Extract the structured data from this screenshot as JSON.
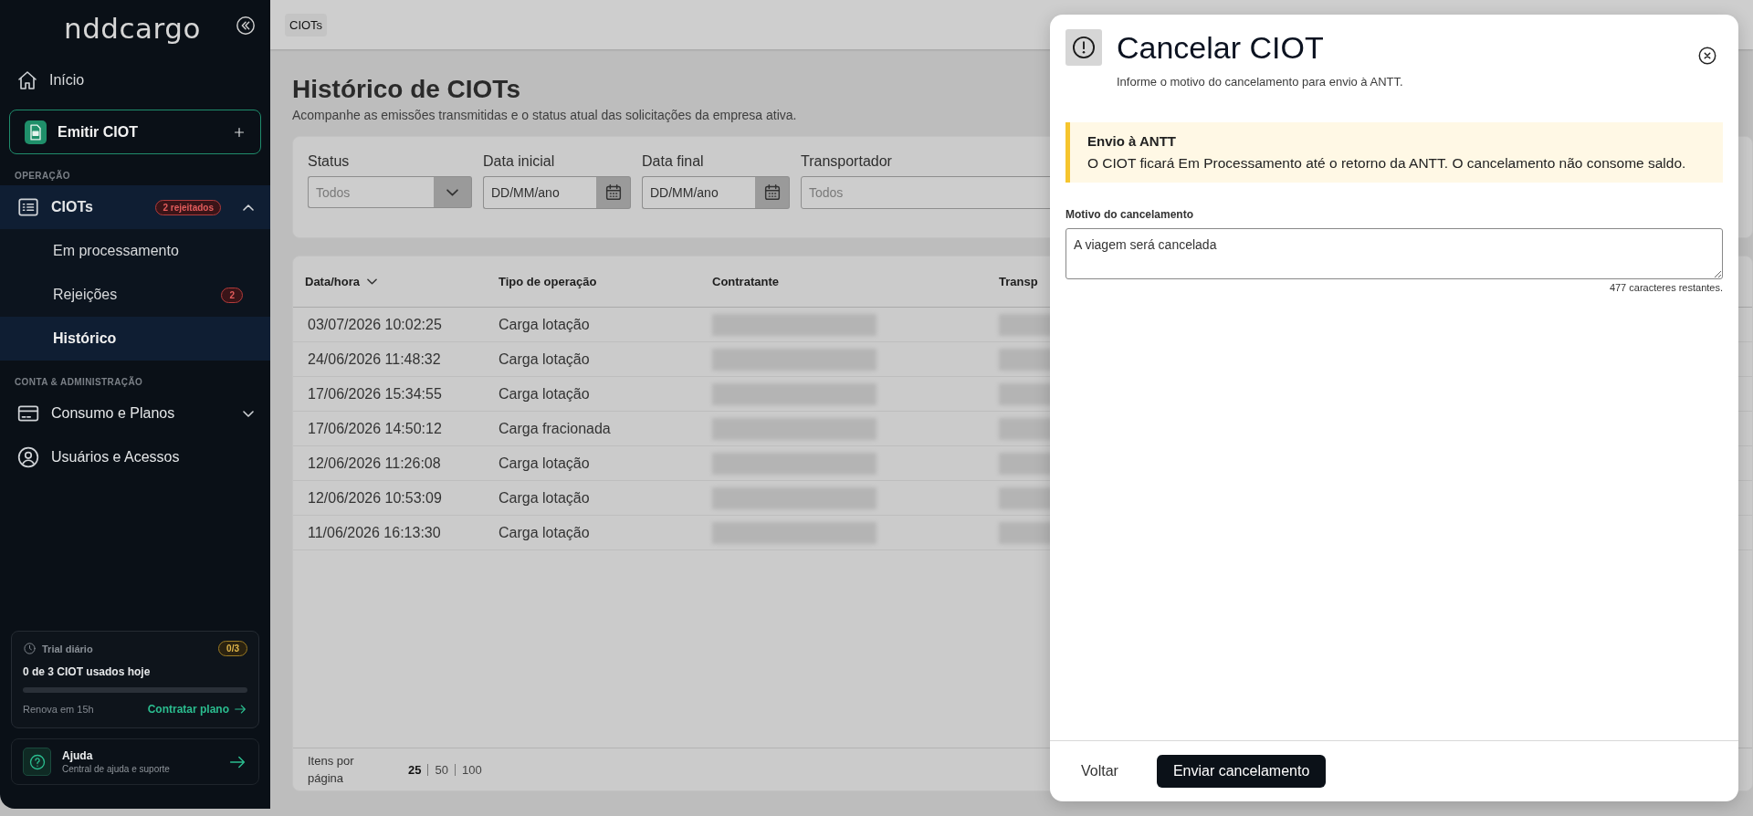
{
  "sidebar": {
    "logo": "nddcargo",
    "nav": [
      {
        "label": "Início",
        "selected": false
      }
    ],
    "primary_action": {
      "label": "Emitir CIOT"
    },
    "sections": [
      {
        "heading": "OPERAÇÃO",
        "items": [
          {
            "label": "CIOTs",
            "selected": true,
            "expanded": true,
            "badge": "2 rejeitados",
            "children": [
              {
                "label": "Em processamento",
                "selected": false
              },
              {
                "label": "Rejeições",
                "selected": false,
                "badge": "2"
              },
              {
                "label": "Histórico",
                "selected": true
              }
            ]
          }
        ]
      },
      {
        "heading": "CONTA & ADMINISTRAÇÃO",
        "items": [
          {
            "label": "Consumo e Planos",
            "selected": false,
            "expanded": false
          },
          {
            "label": "Usuários e Acessos",
            "selected": false
          }
        ]
      }
    ],
    "trial": {
      "title": "Trial diário",
      "badge": "0/3",
      "headline": "0 de 3 CIOT usados hoje",
      "level": 0,
      "renew": "Renova em 15h",
      "link": "Contratar plano"
    },
    "help": {
      "title": "Ajuda",
      "subtitle": "Central de ajuda e suporte"
    }
  },
  "breadcrumb": [
    "CIOTs"
  ],
  "page": {
    "title": "Histórico de CIOTs",
    "subtitle": "Acompanhe as emissões transmitidas e o status atual das solicitações da empresa ativa."
  },
  "filters": [
    {
      "label": "Status",
      "kind": "select",
      "placeholder": "Todos"
    },
    {
      "label": "Data inicial",
      "kind": "date",
      "placeholder": "DD/MM/ano"
    },
    {
      "label": "Data final",
      "kind": "date",
      "placeholder": "DD/MM/ano"
    },
    {
      "label": "Transportador",
      "kind": "text",
      "placeholder": "Todos"
    }
  ],
  "table": {
    "columns": [
      {
        "label": "Data/hora",
        "sorted": true
      },
      {
        "label": "Tipo de operação"
      },
      {
        "label": "Contratante"
      },
      {
        "label": "Transp"
      }
    ],
    "rows": [
      {
        "datetime": "03/07/2026 10:02:25",
        "operation": "Carga lotação"
      },
      {
        "datetime": "24/06/2026 11:48:32",
        "operation": "Carga lotação"
      },
      {
        "datetime": "17/06/2026 15:34:55",
        "operation": "Carga lotação"
      },
      {
        "datetime": "17/06/2026 14:50:12",
        "operation": "Carga fracionada"
      },
      {
        "datetime": "12/06/2026 11:26:08",
        "operation": "Carga lotação"
      },
      {
        "datetime": "12/06/2026 10:53:09",
        "operation": "Carga lotação"
      },
      {
        "datetime": "11/06/2026 16:13:30",
        "operation": "Carga lotação"
      }
    ],
    "pagination": {
      "label": "Itens por página",
      "options": [
        {
          "label": "25",
          "selected": true
        },
        {
          "label": "50",
          "selected": false
        },
        {
          "label": "100",
          "selected": false
        }
      ]
    }
  },
  "modal": {
    "title": "Cancelar CIOT",
    "subtitle": "Informe o motivo do cancelamento para envio à ANTT.",
    "alert": {
      "title": "Envio à ANTT",
      "text": "O CIOT ficará Em Processamento até o retorno da ANTT. O cancelamento não consome saldo."
    },
    "field": {
      "label": "Motivo do cancelamento",
      "value": "A viagem será cancelada",
      "counter": "477 caracteres restantes."
    },
    "buttons": [
      {
        "label": "Voltar",
        "kind": "secondary"
      },
      {
        "label": "Enviar cancelamento",
        "kind": "primary"
      }
    ]
  }
}
